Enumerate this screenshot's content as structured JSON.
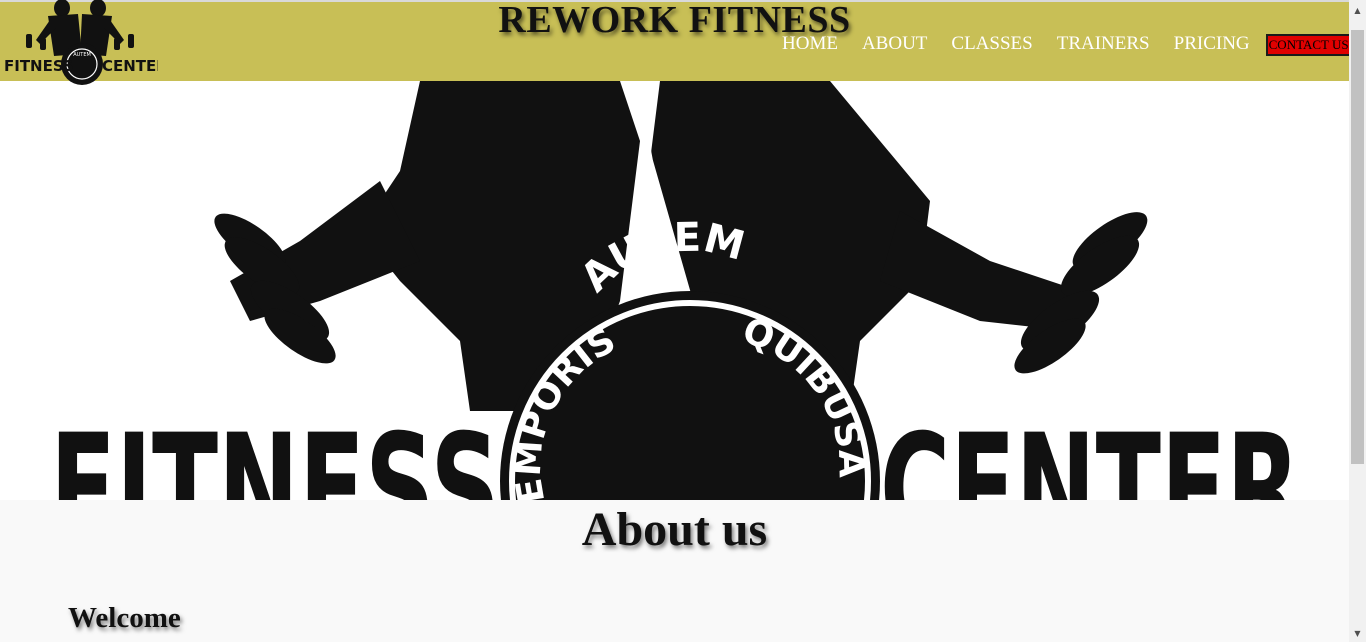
{
  "header": {
    "title": "REWORK FITNESS",
    "nav": [
      "HOME",
      "ABOUT",
      "CLASSES",
      "TRAINERS",
      "PRICING"
    ],
    "contact_label": "CONTACT US",
    "logo_text_left": "FITNESS",
    "logo_text_right": "CENTER",
    "logo_badge_text": "AUTEM"
  },
  "hero": {
    "logo_text_left": "FITNESS",
    "logo_text_right": "CENTER",
    "plate_text_top": "AUTEM",
    "plate_text_left": "EMPORIS",
    "plate_text_right": "QUIBUSA"
  },
  "about": {
    "title": "About us",
    "welcome": "Welcome"
  },
  "colors": {
    "header_bg": "#c8bf56",
    "contact_bg": "#e00000",
    "section_bg": "#f9f9f9",
    "nav_text": "#ffffff"
  },
  "icons": [
    "logo-icon",
    "scroll-up-arrow-icon",
    "scroll-down-arrow-icon"
  ]
}
